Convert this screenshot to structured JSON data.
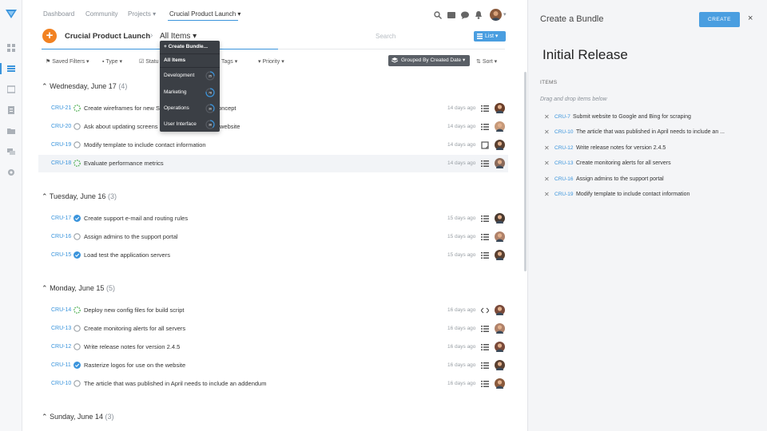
{
  "nav": {
    "links": [
      "Dashboard",
      "Community",
      "Projects",
      "Crucial Product Launch"
    ]
  },
  "project": {
    "title": "Crucial Product Launch",
    "view": "All Items",
    "search_placeholder": "Search",
    "view_mode": "List"
  },
  "filters": {
    "saved": "Saved Filters",
    "type": "Type",
    "status": "Statu",
    "tags": "Tags",
    "priority": "Priority",
    "grouped": "Grouped By Created Date",
    "sort": "Sort"
  },
  "dropdown": {
    "create": "Create Bundle...",
    "items": [
      {
        "label": "All Items",
        "ring": ""
      },
      {
        "label": "Development",
        "ring": "25"
      },
      {
        "label": "Marketing",
        "ring": "78"
      },
      {
        "label": "Operations",
        "ring": "36"
      },
      {
        "label": "User Interface",
        "ring": "38"
      }
    ]
  },
  "groups": [
    {
      "date": "Wednesday, June 17",
      "count": "(4)",
      "rows": [
        {
          "id": "CRU-21",
          "title": "Create wireframes for new S",
          "title_tail": "oncept",
          "age": "14 days ago",
          "status": "progress"
        },
        {
          "id": "CRU-20",
          "title": "Ask about updating screens",
          "title_tail": "website",
          "age": "14 days ago",
          "status": "open"
        },
        {
          "id": "CRU-19",
          "title": "Modify template to include contact information",
          "title_tail": "",
          "age": "14 days ago",
          "status": "open"
        },
        {
          "id": "CRU-18",
          "title": "Evaluate performance metrics",
          "title_tail": "",
          "age": "14 days ago",
          "status": "progress"
        }
      ]
    },
    {
      "date": "Tuesday, June 16",
      "count": "(3)",
      "rows": [
        {
          "id": "CRU-17",
          "title": "Create support e-mail and routing rules",
          "title_tail": "",
          "age": "15 days ago",
          "status": "done"
        },
        {
          "id": "CRU-16",
          "title": "Assign admins to the support portal",
          "title_tail": "",
          "age": "15 days ago",
          "status": "open"
        },
        {
          "id": "CRU-15",
          "title": "Load test the application servers",
          "title_tail": "",
          "age": "15 days ago",
          "status": "done"
        }
      ]
    },
    {
      "date": "Monday, June 15",
      "count": "(5)",
      "rows": [
        {
          "id": "CRU-14",
          "title": "Deploy new config files for build script",
          "title_tail": "",
          "age": "16 days ago",
          "status": "progress"
        },
        {
          "id": "CRU-13",
          "title": "Create monitoring alerts for all servers",
          "title_tail": "",
          "age": "16 days ago",
          "status": "open"
        },
        {
          "id": "CRU-12",
          "title": "Write release notes for version 2.4.5",
          "title_tail": "",
          "age": "16 days ago",
          "status": "open"
        },
        {
          "id": "CRU-11",
          "title": "Rasterize logos for use on the website",
          "title_tail": "",
          "age": "16 days ago",
          "status": "done"
        },
        {
          "id": "CRU-10",
          "title": "The article that was published in April needs to include an addendum",
          "title_tail": "",
          "age": "16 days ago",
          "status": "open"
        }
      ]
    },
    {
      "date": "Sunday, June 14",
      "count": "(3)",
      "rows": []
    }
  ],
  "panel": {
    "title": "Create a Bundle",
    "create_label": "CREATE",
    "close_label": "×",
    "bundle_name": "Initial Release",
    "items_heading": "ITEMS",
    "hint": "Drag and drop items below",
    "items": [
      {
        "id": "CRU-7",
        "title": "Submit website to Google and Bing for scraping"
      },
      {
        "id": "CRU-10",
        "title": "The article that was published in April needs to include an ..."
      },
      {
        "id": "CRU-12",
        "title": "Write release notes for version 2.4.5"
      },
      {
        "id": "CRU-13",
        "title": "Create monitoring alerts for all servers"
      },
      {
        "id": "CRU-16",
        "title": "Assign admins to the support portal"
      },
      {
        "id": "CRU-19",
        "title": "Modify template to include contact information"
      }
    ]
  },
  "colors": {
    "accent": "#3a94dc",
    "orange": "#f28222",
    "done": "#3a94dc",
    "progress": "#4caf50",
    "open": "#9aa0a6"
  }
}
